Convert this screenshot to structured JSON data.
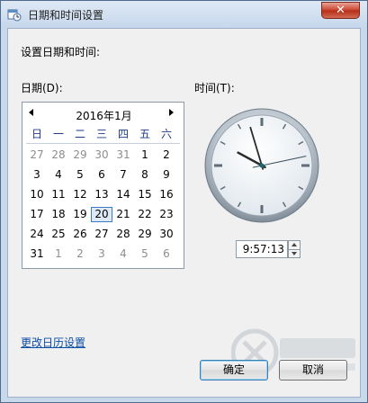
{
  "window": {
    "title": "日期和时间设置",
    "close_glyph": "✕"
  },
  "heading": "设置日期和时间:",
  "date_label": "日期(D):",
  "time_label": "时间(T):",
  "calendar": {
    "month_title": "2016年1月",
    "weekdays": [
      "日",
      "一",
      "二",
      "三",
      "四",
      "五",
      "六"
    ],
    "weeks": [
      [
        "27",
        "28",
        "29",
        "30",
        "31",
        "1",
        "2"
      ],
      [
        "3",
        "4",
        "5",
        "6",
        "7",
        "8",
        "9"
      ],
      [
        "10",
        "11",
        "12",
        "13",
        "14",
        "15",
        "16"
      ],
      [
        "17",
        "18",
        "19",
        "20",
        "21",
        "22",
        "23"
      ],
      [
        "24",
        "25",
        "26",
        "27",
        "28",
        "29",
        "30"
      ],
      [
        "31",
        "1",
        "2",
        "3",
        "4",
        "5",
        "6"
      ]
    ],
    "selected_day": "20"
  },
  "clock": {
    "hour": 9,
    "minute": 57,
    "second": 13
  },
  "time_value": "9:57:13",
  "calendar_settings_link": "更改日历设置",
  "buttons": {
    "ok": "确定",
    "cancel": "取消"
  },
  "colors": {
    "link": "#0b4ea6",
    "selection_border": "#3d79c5",
    "close_red": "#c8412b"
  },
  "icons": [
    "calendar-clock-icon",
    "close-icon",
    "prev-month-icon",
    "next-month-icon",
    "spin-up-icon",
    "spin-down-icon"
  ]
}
